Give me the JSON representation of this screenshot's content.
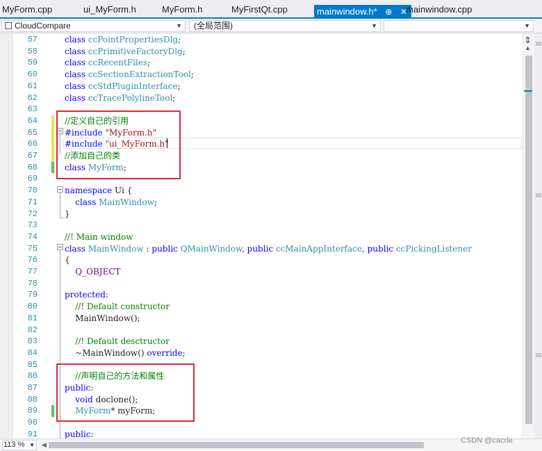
{
  "tabs": [
    {
      "label": "MyForm.cpp",
      "active": false
    },
    {
      "label": "ui_MyForm.h",
      "active": false
    },
    {
      "label": "MyForm.h",
      "active": false
    },
    {
      "label": "MyFirstQt.cpp",
      "active": false
    },
    {
      "label": "mainwindow.h*",
      "active": true
    },
    {
      "label": "mainwindow.cpp",
      "active": false
    }
  ],
  "tab_icons": {
    "pin": "pin-icon",
    "close": "close-icon"
  },
  "nav": {
    "project": "CloudCompare",
    "scope": "(全局范围)",
    "member": ""
  },
  "zoom": "113 %",
  "watermark": "CSDN @cacrle",
  "colors": {
    "accent": "#007acc",
    "keyword": "#0000ff",
    "type": "#2b91af",
    "comment": "#008000",
    "string": "#a31515",
    "macro": "#6f008a",
    "highlight_box": "#e0282e",
    "change_saved": "#57c25c",
    "change_unsaved": "#f0e14b"
  },
  "lines": [
    {
      "n": "57",
      "segs": [
        [
          "k",
          "class "
        ],
        [
          "t",
          "ccPointPropertiesDlg"
        ],
        [
          "p",
          ";"
        ]
      ]
    },
    {
      "n": "58",
      "segs": [
        [
          "k",
          "class "
        ],
        [
          "t",
          "ccPrimitiveFactoryDlg"
        ],
        [
          "p",
          ";"
        ]
      ]
    },
    {
      "n": "59",
      "segs": [
        [
          "k",
          "class "
        ],
        [
          "t",
          "ccRecentFiles"
        ],
        [
          "p",
          ";"
        ]
      ]
    },
    {
      "n": "60",
      "segs": [
        [
          "k",
          "class "
        ],
        [
          "t",
          "ccSectionExtractionTool"
        ],
        [
          "p",
          ";"
        ]
      ]
    },
    {
      "n": "61",
      "segs": [
        [
          "k",
          "class "
        ],
        [
          "t",
          "ccStdPluginInterface"
        ],
        [
          "p",
          ";"
        ]
      ]
    },
    {
      "n": "62",
      "segs": [
        [
          "k",
          "class "
        ],
        [
          "t",
          "ccTracePolylineTool"
        ],
        [
          "p",
          ";"
        ]
      ]
    },
    {
      "n": "63",
      "segs": []
    },
    {
      "n": "64",
      "segs": [
        [
          "c",
          "//定义自己的引用"
        ]
      ],
      "marker": "yellow"
    },
    {
      "n": "65",
      "segs": [
        [
          "k",
          "#include "
        ],
        [
          "s",
          "\"MyForm.h\""
        ]
      ],
      "marker": "yellow"
    },
    {
      "n": "66",
      "segs": [
        [
          "k",
          "#include "
        ],
        [
          "s",
          "\"ui_MyForm.h\""
        ]
      ],
      "marker": "yellow"
    },
    {
      "n": "67",
      "segs": [
        [
          "c",
          "//添加自己的类"
        ]
      ],
      "marker": "yellow"
    },
    {
      "n": "68",
      "segs": [
        [
          "k",
          "class "
        ],
        [
          "t",
          "MyForm"
        ],
        [
          "p",
          ";"
        ]
      ],
      "marker": "green"
    },
    {
      "n": "69",
      "segs": []
    },
    {
      "n": "70",
      "segs": [
        [
          "k",
          "namespace "
        ],
        [
          "p",
          "Ui {"
        ]
      ]
    },
    {
      "n": "71",
      "segs": [
        [
          "p",
          "    "
        ],
        [
          "k",
          "class "
        ],
        [
          "t",
          "MainWindow"
        ],
        [
          "p",
          ";"
        ]
      ]
    },
    {
      "n": "72",
      "segs": [
        [
          "p",
          "}"
        ]
      ]
    },
    {
      "n": "73",
      "segs": []
    },
    {
      "n": "74",
      "segs": [
        [
          "c",
          "//! Main window"
        ]
      ]
    },
    {
      "n": "75",
      "segs": [
        [
          "k",
          "class "
        ],
        [
          "t",
          "MainWindow"
        ],
        [
          "p",
          " : "
        ],
        [
          "k",
          "public "
        ],
        [
          "t",
          "QMainWindow"
        ],
        [
          "p",
          ", "
        ],
        [
          "k",
          "public "
        ],
        [
          "t",
          "ccMainAppInterface"
        ],
        [
          "p",
          ", "
        ],
        [
          "k",
          "public "
        ],
        [
          "t",
          "ccPickingListener"
        ]
      ]
    },
    {
      "n": "76",
      "segs": [
        [
          "p",
          "{"
        ]
      ]
    },
    {
      "n": "77",
      "segs": [
        [
          "p",
          "    "
        ],
        [
          "m",
          "Q_OBJECT"
        ]
      ]
    },
    {
      "n": "78",
      "segs": []
    },
    {
      "n": "79",
      "segs": [
        [
          "k",
          "protected"
        ],
        [
          "p",
          ":"
        ]
      ]
    },
    {
      "n": "80",
      "segs": [
        [
          "p",
          "    "
        ],
        [
          "c",
          "//! Default constructor"
        ]
      ]
    },
    {
      "n": "81",
      "segs": [
        [
          "p",
          "    MainWindow();"
        ]
      ]
    },
    {
      "n": "82",
      "segs": []
    },
    {
      "n": "83",
      "segs": [
        [
          "p",
          "    "
        ],
        [
          "c",
          "//! Default desctructor"
        ]
      ]
    },
    {
      "n": "84",
      "segs": [
        [
          "p",
          "    ~MainWindow() "
        ],
        [
          "k",
          "override"
        ],
        [
          "p",
          ";"
        ]
      ]
    },
    {
      "n": "85",
      "segs": []
    },
    {
      "n": "86",
      "segs": [
        [
          "p",
          "    "
        ],
        [
          "c",
          "//声明自己的方法和属性"
        ]
      ]
    },
    {
      "n": "87",
      "segs": [
        [
          "k",
          "public"
        ],
        [
          "p",
          ":"
        ]
      ]
    },
    {
      "n": "88",
      "segs": [
        [
          "p",
          "    "
        ],
        [
          "k",
          "void "
        ],
        [
          "p",
          "doclone();"
        ]
      ]
    },
    {
      "n": "89",
      "segs": [
        [
          "p",
          "    "
        ],
        [
          "t",
          "MyForm"
        ],
        [
          "p",
          "* myForm;"
        ]
      ],
      "marker": "green"
    },
    {
      "n": "90",
      "segs": []
    },
    {
      "n": "91",
      "segs": [
        [
          "k",
          "public"
        ],
        [
          "p",
          ":"
        ]
      ]
    }
  ]
}
